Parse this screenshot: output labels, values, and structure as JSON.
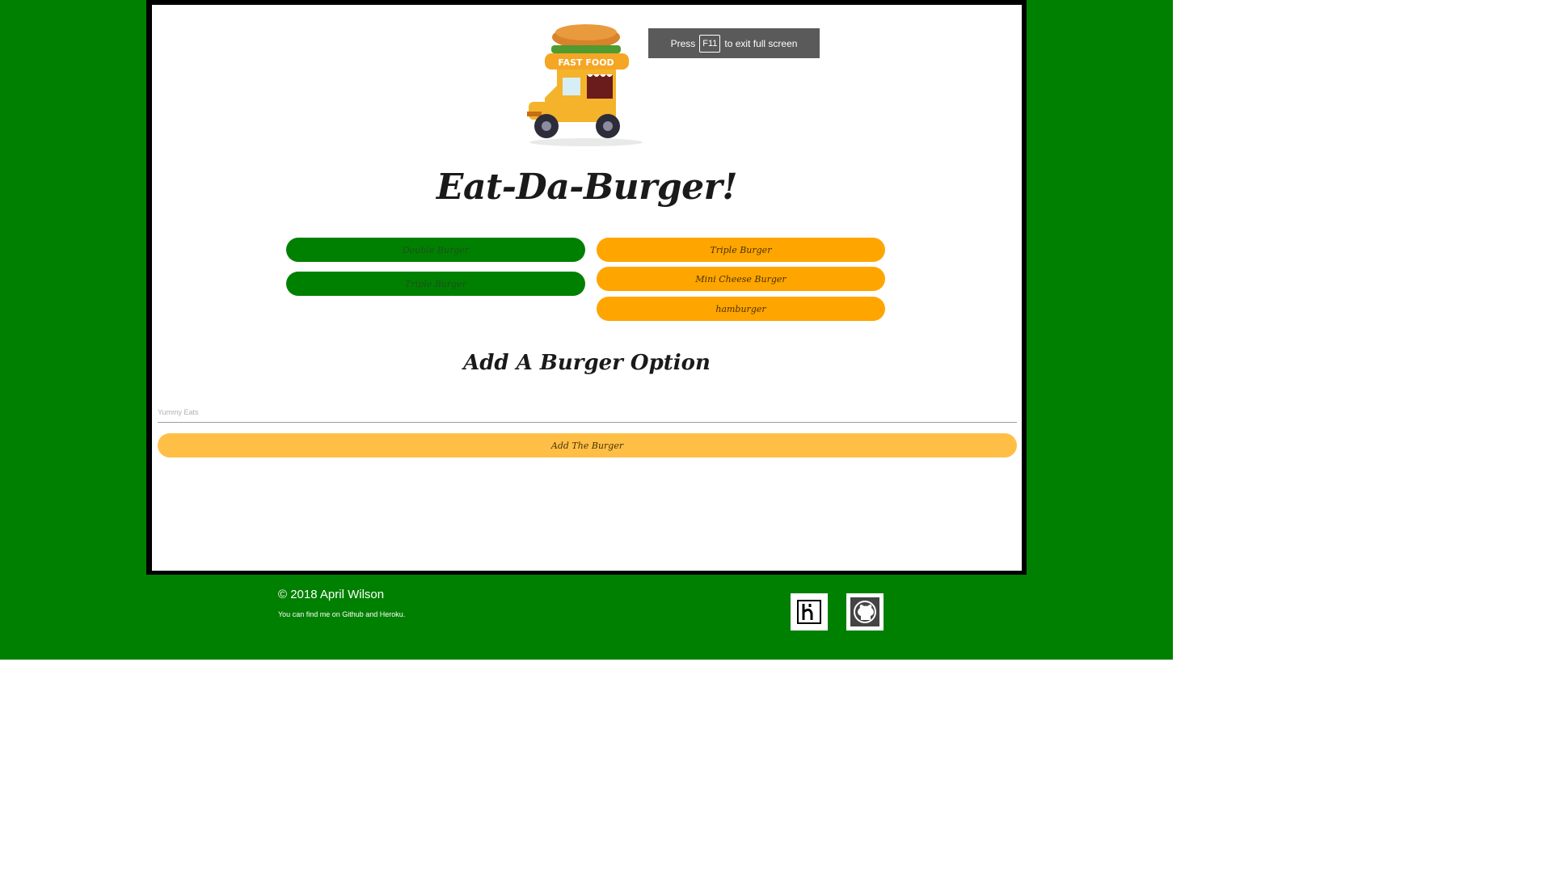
{
  "fullscreen_notice": {
    "press": "Press",
    "key": "F11",
    "suffix": "to exit full screen"
  },
  "logo": {
    "label": "FAST FOOD"
  },
  "header": {
    "title": "Eat-Da-Burger!"
  },
  "devoured_burgers": [
    {
      "label": "Double Burger"
    },
    {
      "label": "Triple Burger"
    }
  ],
  "ready_burgers": [
    {
      "label": "Triple Burger"
    },
    {
      "label": "Mini Cheese Burger"
    },
    {
      "label": "hamburger"
    }
  ],
  "add_section": {
    "title": "Add A Burger Option",
    "input_placeholder": "Yummy Eats",
    "button_label": "Add The Burger"
  },
  "footer": {
    "copyright": "© 2018 April Wilson",
    "note": "You can find me on Github and Heroku."
  },
  "colors": {
    "page_green": "#008000",
    "devoured_button": "#008000",
    "ready_button": "#ffa500",
    "add_button": "#ffbf47"
  },
  "icons": {
    "heroku": "heroku-icon",
    "github": "github-icon"
  }
}
